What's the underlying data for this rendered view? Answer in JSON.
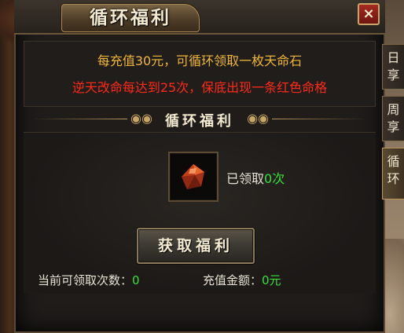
{
  "window": {
    "title": "循环福利",
    "close_label": "×"
  },
  "info": {
    "line1": "每充值30元，可循环领取一枚天命石",
    "line2": "逆天改命每达到25次，保底出现一条红色命格"
  },
  "section": {
    "title": "循环福利",
    "ornament_left": "◉◉",
    "ornament_right": "◉◉"
  },
  "reward": {
    "icon": "red-gem-icon",
    "claimed_prefix": "已领取",
    "claimed_count": "0次"
  },
  "claim_button": {
    "label": "获取福利"
  },
  "footer": {
    "claimable_label": "当前可领取次数：",
    "claimable_value": "0",
    "recharge_label": "充值金额：",
    "recharge_value": "0元"
  },
  "side_tabs": [
    {
      "label": "日享",
      "active": false
    },
    {
      "label": "周享",
      "active": false
    },
    {
      "label": "循环",
      "active": true
    }
  ],
  "colors": {
    "info_gold": "#f0b63a",
    "info_red": "#ff2a18",
    "value_green": "#36e23a"
  }
}
